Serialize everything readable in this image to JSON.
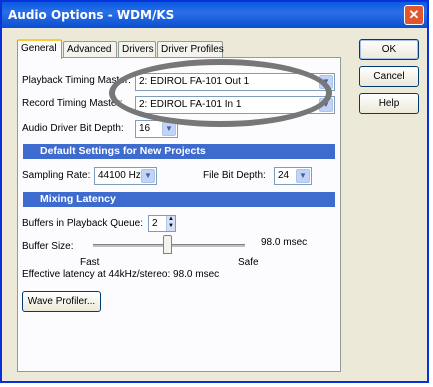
{
  "window": {
    "title": "Audio Options - WDM/KS",
    "close_glyph": "✕"
  },
  "tabs": [
    {
      "label": "General"
    },
    {
      "label": "Advanced"
    },
    {
      "label": "Drivers"
    },
    {
      "label": "Driver Profiles"
    }
  ],
  "buttons": {
    "ok": "OK",
    "cancel": "Cancel",
    "help": "Help"
  },
  "general": {
    "playback_label": "Playback Timing Master:",
    "playback_value": "2: EDIROL FA-101 Out 1",
    "record_label": "Record Timing Master:",
    "record_value": "2: EDIROL FA-101 In 1",
    "bit_depth_label": "Audio Driver Bit Depth:",
    "bit_depth_value": "16"
  },
  "defaults_section": {
    "title": "Default Settings for New Projects",
    "sampling_rate_label": "Sampling Rate:",
    "sampling_rate_value": "44100 Hz",
    "file_bit_depth_label": "File Bit Depth:",
    "file_bit_depth_value": "24"
  },
  "latency_section": {
    "title": "Mixing Latency",
    "buffers_label": "Buffers in Playback Queue:",
    "buffers_value": "2",
    "buffer_size_label": "Buffer Size:",
    "buffer_size_value": "98.0 msec",
    "buffer_size_level": 0.49,
    "fast_label": "Fast",
    "safe_label": "Safe",
    "effective_latency": "Effective latency at 44kHz/stereo:  98.0 msec"
  },
  "wave_profiler_label": "Wave Profiler...",
  "icons": {
    "dropdown": "chevron-down-icon",
    "spin": "spin-arrows-icon"
  },
  "colors": {
    "titlebar": "#0a5ae3",
    "section_header": "#3e6bce",
    "highlight_oval": "#777777"
  }
}
